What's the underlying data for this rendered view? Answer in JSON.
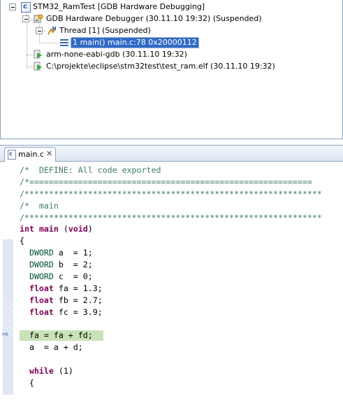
{
  "debug_tree": {
    "launch": "STM32_RamTest [GDB Hardware Debugging]",
    "debugger": "GDB Hardware Debugger (30.11.10 19:32) (Suspended)",
    "thread": "Thread [1] (Suspended)",
    "frame": "1 main() main.c:78 0x20000112",
    "gdb_process": "arm-none-eabi-gdb (30.11.10 19:32)",
    "elf_process": "C:\\projekte\\eclipse\\stm32test\\test_ram.elf (30.11.10 19:32)"
  },
  "editor": {
    "tab_label": "main.c",
    "tab_icon_letter": "c",
    "launch_icon_letter": "c",
    "close_symbol": "✕",
    "current_line_marker": "⇨"
  },
  "code_lines": [
    [
      [
        "comment",
        "/*  DEFINE: All code exported"
      ]
    ],
    [
      [
        "comment",
        "/*=========================================================="
      ]
    ],
    [
      [
        "comment",
        "/*************************************************************"
      ]
    ],
    [
      [
        "comment",
        "/*  main"
      ]
    ],
    [
      [
        "comment",
        "/*************************************************************"
      ]
    ],
    [
      [
        "kw",
        "int"
      ],
      [
        "plain",
        " "
      ],
      [
        "kw",
        "main"
      ],
      [
        "plain",
        " ("
      ],
      [
        "kw",
        "void"
      ],
      [
        "plain",
        ")"
      ]
    ],
    [
      [
        "plain",
        "{"
      ]
    ],
    [
      [
        "plain",
        "  "
      ],
      [
        "type",
        "DWORD"
      ],
      [
        "plain",
        " a  = 1;"
      ]
    ],
    [
      [
        "plain",
        "  "
      ],
      [
        "type",
        "DWORD"
      ],
      [
        "plain",
        " b  = 2;"
      ]
    ],
    [
      [
        "plain",
        "  "
      ],
      [
        "type",
        "DWORD"
      ],
      [
        "plain",
        " c  = 0;"
      ]
    ],
    [
      [
        "plain",
        "  "
      ],
      [
        "kw",
        "float"
      ],
      [
        "plain",
        " fa = 1.3;"
      ]
    ],
    [
      [
        "plain",
        "  "
      ],
      [
        "kw",
        "float"
      ],
      [
        "plain",
        " fb = 2.7;"
      ]
    ],
    [
      [
        "plain",
        "  "
      ],
      [
        "kw",
        "float"
      ],
      [
        "plain",
        " fc = 3.9;"
      ]
    ],
    [],
    [
      [
        "plain",
        "  fa = fa + fd;"
      ]
    ],
    [
      [
        "plain",
        "  a  = a + d;"
      ]
    ],
    [],
    [
      [
        "plain",
        "  "
      ],
      [
        "kw",
        "while"
      ],
      [
        "plain",
        " (1)"
      ]
    ],
    [
      [
        "plain",
        "  {"
      ]
    ],
    [
      [
        "plain",
        "    "
      ]
    ]
  ],
  "highlighted_line_index": 14,
  "colors": {
    "comment": "#3f7f5f",
    "keyword": "#7f0055",
    "type": "#005032",
    "selection": "#316ac5",
    "current_line": "#c9e2b8"
  }
}
